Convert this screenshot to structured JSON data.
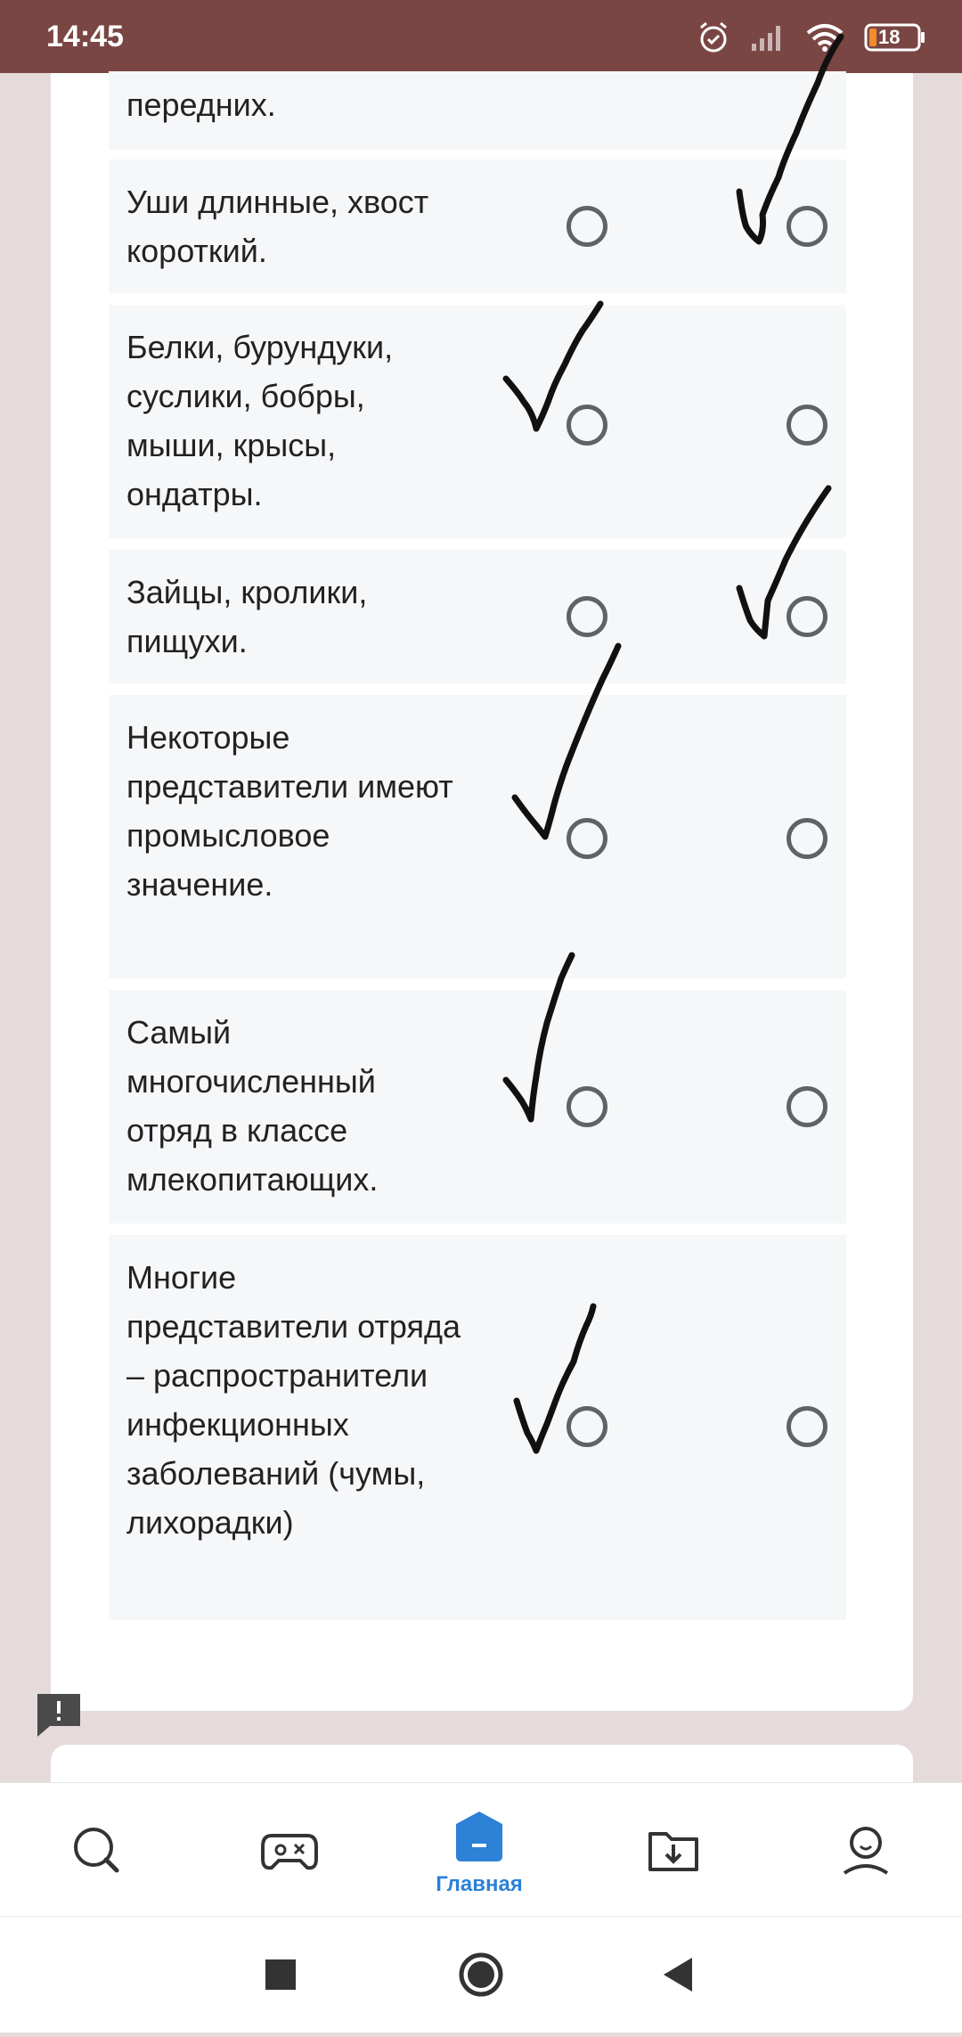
{
  "status_bar": {
    "time": "14:45",
    "battery": "18",
    "icons": [
      "alarm-icon",
      "signal-icon",
      "wifi-icon",
      "battery-icon"
    ]
  },
  "quiz": {
    "rows": [
      {
        "text": "передних.",
        "checked": "none"
      },
      {
        "text": "Уши длинные, хвост короткий.",
        "checked": "col2"
      },
      {
        "text": "Белки, бурундуки, суслики, бобры, мыши, крысы, ондатры.",
        "checked": "col1"
      },
      {
        "text": "Зайцы, кролики, пищухи.",
        "checked": "col2"
      },
      {
        "text": "Некоторые представители имеют промысловое значение.",
        "checked": "col1"
      },
      {
        "text": "Самый многочисленный отряд в классе млекопитающих.",
        "checked": "col1"
      },
      {
        "text": "Многие представители отряда – распространители инфекционных заболеваний (чумы, лихорадки)",
        "checked": "col1"
      }
    ]
  },
  "bottom_nav": {
    "items": [
      {
        "icon": "search-icon",
        "label": ""
      },
      {
        "icon": "gamepad-icon",
        "label": ""
      },
      {
        "icon": "home-icon",
        "label": "Главная",
        "active": true
      },
      {
        "icon": "download-folder-icon",
        "label": ""
      },
      {
        "icon": "profile-icon",
        "label": ""
      }
    ]
  },
  "colors": {
    "status_bar": "#7a4644",
    "background": "#e6dbdb",
    "accent": "#2d81d6",
    "radio": "#5f6368"
  }
}
